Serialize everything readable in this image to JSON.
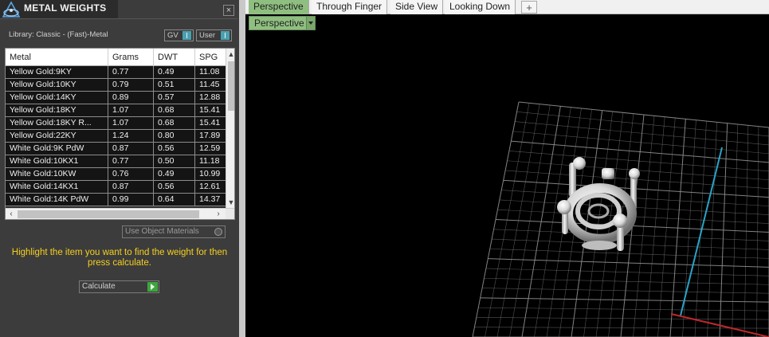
{
  "panel": {
    "title": "METAL WEIGHTS",
    "close_label": "×",
    "library_text": "Library: Classic - (Fast)-Metal",
    "toggle_gv": "GV",
    "toggle_user": "User",
    "table": {
      "columns": [
        "Metal",
        "Grams",
        "DWT",
        "SPG"
      ],
      "rows": [
        [
          "Yellow Gold:9KY",
          "0.77",
          "0.49",
          "11.08"
        ],
        [
          "Yellow Gold:10KY",
          "0.79",
          "0.51",
          "11.45"
        ],
        [
          "Yellow Gold:14KY",
          "0.89",
          "0.57",
          "12.88"
        ],
        [
          "Yellow Gold:18KY",
          "1.07",
          "0.68",
          "15.41"
        ],
        [
          "Yellow Gold:18KY R...",
          "1.07",
          "0.68",
          "15.41"
        ],
        [
          "Yellow Gold:22KY",
          "1.24",
          "0.80",
          "17.89"
        ],
        [
          "White Gold:9K PdW",
          "0.87",
          "0.56",
          "12.59"
        ],
        [
          "White Gold:10KX1",
          "0.77",
          "0.50",
          "11.18"
        ],
        [
          "White Gold:10KW",
          "0.76",
          "0.49",
          "10.99"
        ],
        [
          "White Gold:14KX1",
          "0.87",
          "0.56",
          "12.61"
        ],
        [
          "White Gold:14K PdW",
          "0.99",
          "0.64",
          "14.37"
        ]
      ]
    },
    "use_object_materials_label": "Use Object Materials",
    "hint": "Highlight the item you want to find the weight for then press calculate.",
    "calculate_label": "Calculate"
  },
  "viewport": {
    "tabs": [
      "Perspective",
      "Through Finger",
      "Side View",
      "Looking Down"
    ],
    "add_tab_label": "+",
    "view_dropdown": "Perspective",
    "colors": {
      "grid": "#8a8a8a",
      "axis_y": "#2aa3c7",
      "axis_x": "#c0282a",
      "tab_active": "#8fbf80"
    }
  }
}
